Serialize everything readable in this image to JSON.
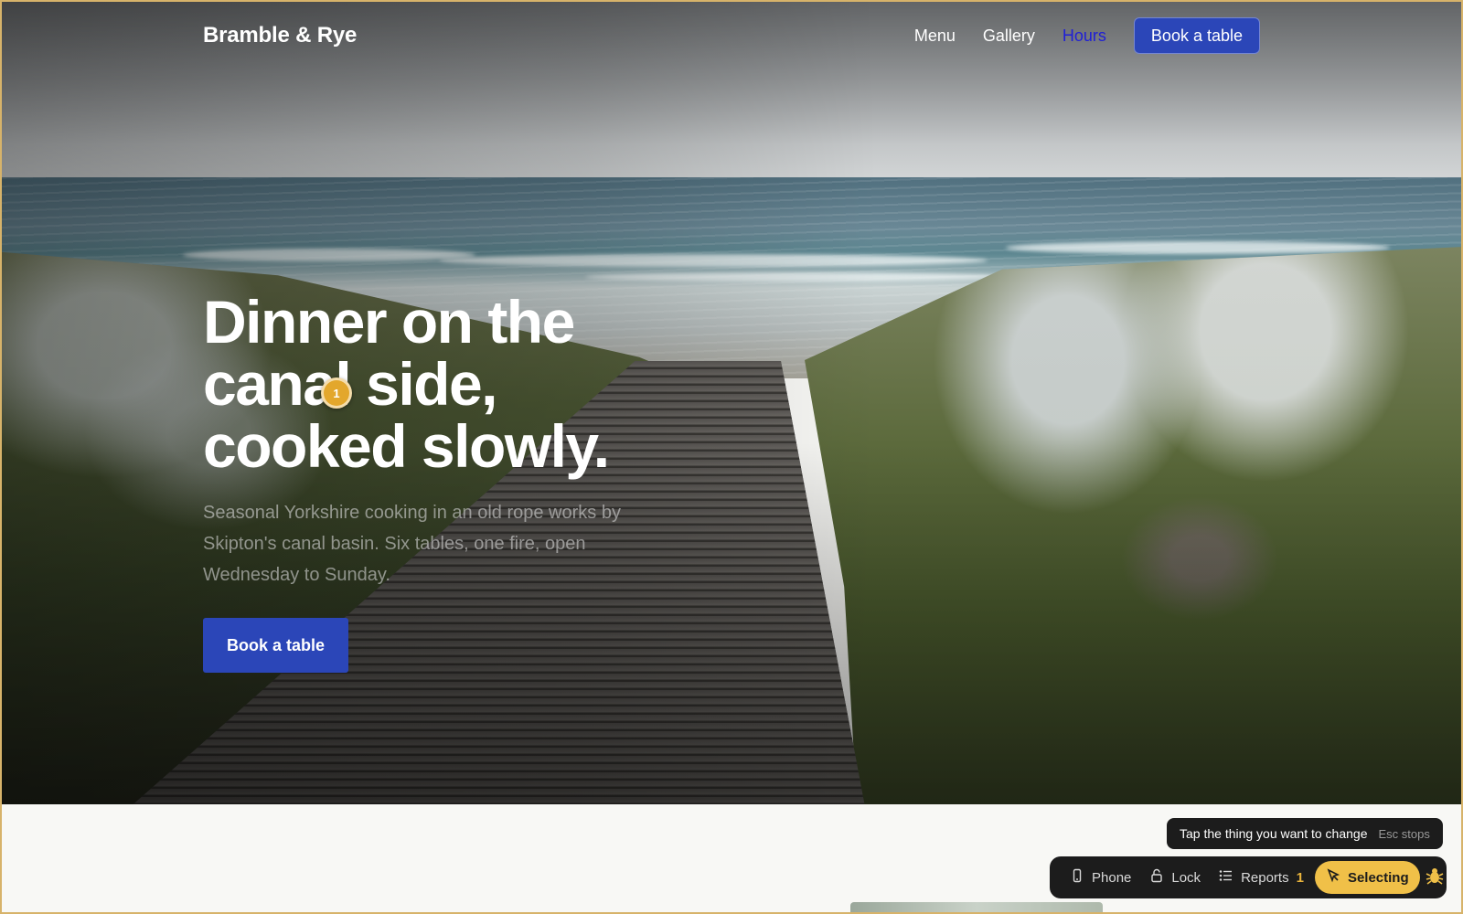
{
  "header": {
    "brand": "Bramble & Rye",
    "nav": [
      {
        "label": "Menu"
      },
      {
        "label": "Gallery"
      },
      {
        "label": "Hours"
      }
    ],
    "cta_label": "Book a table"
  },
  "hero": {
    "title_line1": "Dinner on the",
    "title_line2": "canal side,",
    "title_line3": "cooked slowly.",
    "subtitle": "Seasonal Yorkshire cooking in an old rope works by Skipton's canal basin. Six tables, one fire, open Wednesday to Sunday.",
    "cta_label": "Book a table"
  },
  "annotation_marker": {
    "label": "1"
  },
  "tooltip": {
    "text": "Tap the thing you want to change",
    "hint": "Esc stops"
  },
  "toolbar": {
    "phone_label": "Phone",
    "lock_label": "Lock",
    "reports_label": "Reports",
    "reports_count": "1",
    "selecting_label": "Selecting"
  },
  "colors": {
    "accent": "#2b46b8",
    "active_link": "#1f1fd6",
    "marker": "#e3a72c",
    "selecting": "#f0c048",
    "toolbar_bg": "#1c1c1c"
  },
  "icons": [
    "phone-icon",
    "lock-icon",
    "list-icon",
    "cursor-icon",
    "bug-icon"
  ]
}
